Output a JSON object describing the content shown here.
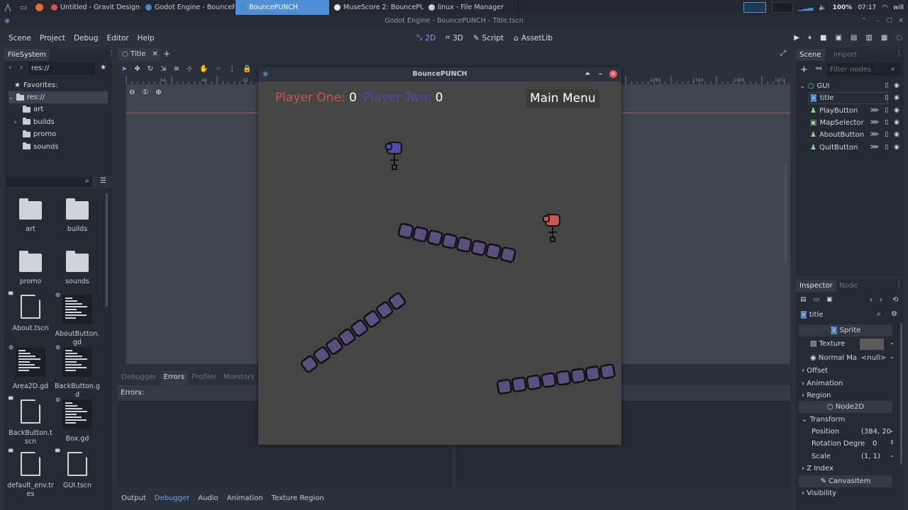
{
  "taskbar": {
    "tasks": [
      {
        "label": "Untitled - Gravit Designer -...",
        "color": "#d9534f"
      },
      {
        "label": "Godot Engine - BouncePU...",
        "color": "#478cbf"
      },
      {
        "label": "BouncePUNCH",
        "color": "#478cbf",
        "active": true
      },
      {
        "label": "MuseScore 2: BouncePUN...",
        "color": "#e7e7e7"
      },
      {
        "label": "linux - File Manager",
        "color": "#c7ccd4"
      }
    ],
    "battery": "100%",
    "time": "07:17",
    "user": "will"
  },
  "window": {
    "title": "Godot Engine - BouncePUNCH - Title.tscn"
  },
  "menu": {
    "items": [
      "Scene",
      "Project",
      "Debug",
      "Editor",
      "Help"
    ]
  },
  "modes": [
    {
      "label": "2D",
      "active": true
    },
    {
      "label": "3D"
    },
    {
      "label": "Script"
    },
    {
      "label": "AssetLib"
    }
  ],
  "filesystem": {
    "tab": "FileSystem",
    "path": "res://",
    "favorites": "Favorites:",
    "root": "res://",
    "folders": [
      "art",
      "builds",
      "promo",
      "sounds"
    ],
    "grid": [
      {
        "name": "art",
        "kind": "folder"
      },
      {
        "name": "builds",
        "kind": "folder"
      },
      {
        "name": "promo",
        "kind": "folder"
      },
      {
        "name": "sounds",
        "kind": "folder"
      },
      {
        "name": "About.tscn",
        "kind": "file"
      },
      {
        "name": "AboutButton.gd",
        "kind": "script"
      },
      {
        "name": "Area2D.gd",
        "kind": "script"
      },
      {
        "name": "BackButton.gd",
        "kind": "script"
      },
      {
        "name": "BackButton.tscn",
        "kind": "file"
      },
      {
        "name": "Box.gd",
        "kind": "script"
      },
      {
        "name": "default_env.tres",
        "kind": "file"
      },
      {
        "name": "GUI.tscn",
        "kind": "file"
      }
    ]
  },
  "editor": {
    "tab": "Title"
  },
  "scene": {
    "tabs": [
      "Scene",
      "Import"
    ],
    "filter_placeholder": "Filter nodes",
    "nodes": [
      {
        "name": "GUI",
        "depth": 0
      },
      {
        "name": "title",
        "depth": 1,
        "selected": true
      },
      {
        "name": "PlayButton",
        "depth": 1
      },
      {
        "name": "MapSelector",
        "depth": 1
      },
      {
        "name": "AboutButton",
        "depth": 1
      },
      {
        "name": "QuitButton",
        "depth": 1
      }
    ]
  },
  "inspector": {
    "tabs": [
      "Inspector",
      "Node"
    ],
    "object": "title",
    "sprite_header": "Sprite",
    "texture_label": "Texture",
    "normal_label": "Normal Ma",
    "normal_value": "<null>",
    "sections": [
      "Offset",
      "Animation",
      "Region"
    ],
    "node2d_header": "Node2D",
    "transform": "Transform",
    "position_label": "Position",
    "position_value": "(384, 20",
    "rotation_label": "Rotation Degre",
    "rotation_value": "0",
    "scale_label": "Scale",
    "scale_value": "(1, 1)",
    "zindex": "Z Index",
    "canvas_header": "CanvasItem",
    "visibility": "Visibility"
  },
  "bottom": {
    "tabs": [
      "Debugger",
      "Errors",
      "Profiler",
      "Monitors"
    ],
    "active_tab": "Errors",
    "errors_label": "Errors:",
    "panel_tabs": [
      "Output",
      "Debugger",
      "Audio",
      "Animation",
      "Texture Region"
    ]
  },
  "ruler": {
    "ticks": [
      "64",
      "48",
      "32",
      "1280",
      "1344",
      "1408",
      "1472"
    ]
  },
  "game": {
    "title": "BouncePUNCH",
    "player_one_label": "Player One:",
    "player_one_score": "0",
    "player_two_label": "Player Two:",
    "player_two_score": "0",
    "menu_button": "Main Menu",
    "colors": {
      "p1": "#c9574f",
      "p2": "#4b4fa8",
      "box": "#5a4f7d"
    }
  }
}
